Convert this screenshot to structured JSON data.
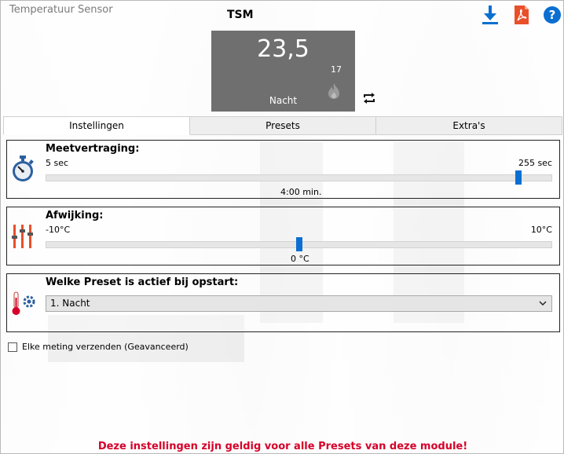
{
  "window": {
    "title": "Temperatuur Sensor",
    "device_name": "TSM"
  },
  "toolbar": {
    "icons": [
      "download-icon",
      "pdf-icon",
      "help-icon"
    ],
    "accent": "#0a6fd1",
    "pdf_color": "#e8502a"
  },
  "display": {
    "temperature": "23,5",
    "setpoint": "17",
    "mode": "Nacht",
    "background": "#6f6f6f"
  },
  "tabs": [
    {
      "label": "Instellingen",
      "active": true
    },
    {
      "label": "Presets",
      "active": false
    },
    {
      "label": "Extra's",
      "active": false
    }
  ],
  "meetvertraging": {
    "title": "Meetvertraging:",
    "min_label": "5 sec",
    "max_label": "255 sec",
    "min": 5,
    "max": 255,
    "value_label": "4:00 min."
  },
  "afwijking": {
    "title": "Afwijking:",
    "min_label": "-10°C",
    "max_label": "10°C",
    "min": -10,
    "max": 10,
    "value": 0,
    "value_label": "0 °C"
  },
  "preset": {
    "title": "Welke Preset is actief bij opstart:",
    "selected": "1. Nacht"
  },
  "advanced": {
    "label": "Elke meting verzenden (Geavanceerd)",
    "checked": false
  },
  "footer": {
    "note": "Deze instellingen zijn geldig voor alle Presets van deze module!",
    "color": "#d6002a"
  }
}
